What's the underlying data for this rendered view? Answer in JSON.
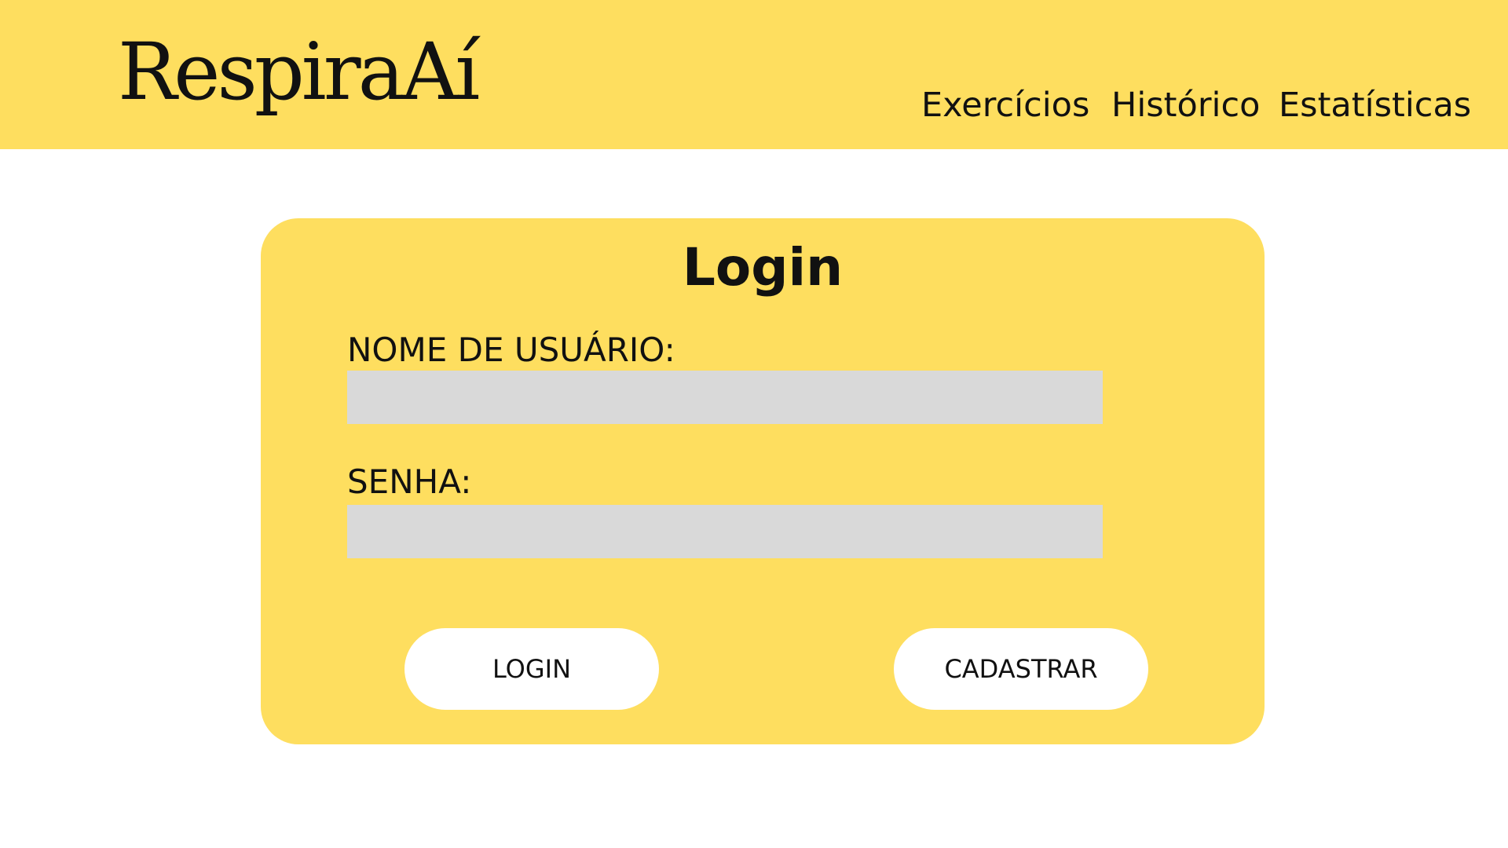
{
  "header": {
    "logo_text": "RespiraAí",
    "nav": [
      {
        "label": "Exercícios"
      },
      {
        "label": "Histórico"
      },
      {
        "label": "Estatísticas"
      }
    ]
  },
  "login_card": {
    "title": "Login",
    "username_label": "NOME DE USUÁRIO:",
    "username_value": "",
    "password_label": "SENHA:",
    "password_value": "",
    "login_button": "LOGIN",
    "signup_button": "CADASTRAR"
  },
  "colors": {
    "accent_yellow": "#FEDE5F",
    "input_gray": "#D9D9D9",
    "button_white": "#FFFFFF"
  }
}
